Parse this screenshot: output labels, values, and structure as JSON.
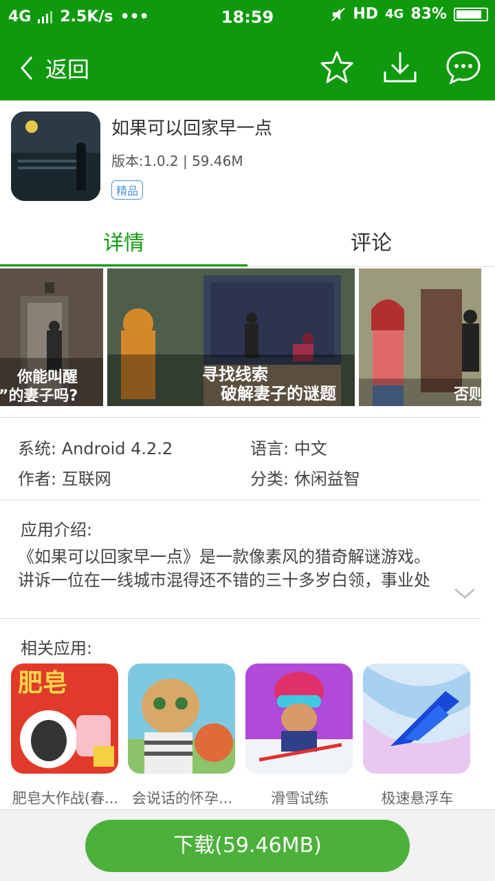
{
  "status": {
    "network": "4G",
    "speed": "2.5K/s",
    "dots": "•••",
    "time": "18:59",
    "hd": "HD",
    "net2": "4G",
    "battery": "83%"
  },
  "header": {
    "back_label": "返回"
  },
  "app": {
    "name": "如果可以回家早一点",
    "version": "版本:1.0.2 | 59.46M",
    "badge": "精品"
  },
  "tabs": [
    "详情",
    "评论"
  ],
  "screenshots": [
    {
      "caption_1": "你能叫醒",
      "caption_2": "”的妻子吗?"
    },
    {
      "caption_1": "寻找线索",
      "caption_2": "破解妻子的谜题"
    },
    {
      "caption_1": "否则"
    }
  ],
  "meta": {
    "system_label": "系统:",
    "system_value": "Android 4.2.2",
    "language_label": "语言:",
    "language_value": "中文",
    "author_label": "作者:",
    "author_value": "互联网",
    "category_label": "分类:",
    "category_value": "休闲益智"
  },
  "description": {
    "title": "应用介绍:",
    "line1": "《如果可以回家早一点》是一款像素风的猎奇解谜游戏。",
    "line2": "讲诉一位在一线城市混得还不错的三十多岁白领，事业处"
  },
  "related": {
    "title": "相关应用:",
    "items": [
      {
        "name": "肥皂大作战(春...",
        "art_text": "肥皂"
      },
      {
        "name": "会说话的怀孕..."
      },
      {
        "name": "滑雪试练"
      },
      {
        "name": "极速悬浮车"
      }
    ]
  },
  "download": {
    "label": "下载(59.46MB)"
  },
  "colors": {
    "brand_green": "#0f9a0e",
    "button_green": "#4bb13a",
    "badge_blue": "#4a90d9"
  }
}
